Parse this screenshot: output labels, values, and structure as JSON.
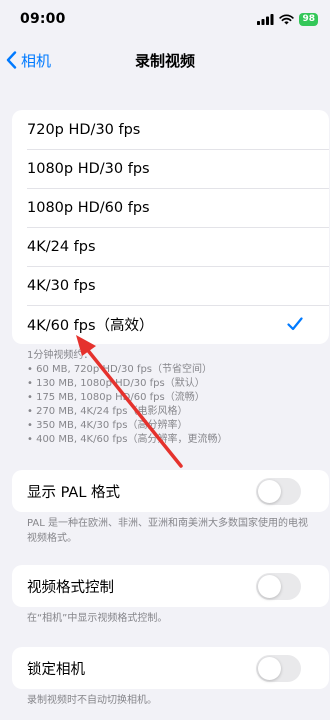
{
  "status_bar": {
    "time": "09:00",
    "battery": "98",
    "icons": [
      "signal-icon",
      "wifi-icon",
      "battery-icon"
    ]
  },
  "nav": {
    "back_label": "相机",
    "title": "录制视频"
  },
  "resolutions": [
    {
      "label": "720p HD/30 fps",
      "selected": false
    },
    {
      "label": "1080p HD/30 fps",
      "selected": false
    },
    {
      "label": "1080p HD/60 fps",
      "selected": false
    },
    {
      "label": "4K/24 fps",
      "selected": false
    },
    {
      "label": "4K/30 fps",
      "selected": false
    },
    {
      "label": "4K/60 fps（高效）",
      "selected": true
    }
  ],
  "size_info": [
    "1分钟视频约：",
    "• 60 MB, 720p HD/30 fps（节省空间）",
    "• 130 MB, 1080p HD/30 fps（默认）",
    "• 175 MB, 1080p HD/60 fps（流畅）",
    "• 270 MB, 4K/24 fps（电影风格）",
    "• 350 MB, 4K/30 fps（高分辨率）",
    "• 400 MB, 4K/60 fps（高分辨率，更流畅）"
  ],
  "pal": {
    "label": "显示 PAL 格式",
    "on": false,
    "footnote": "PAL 是一种在欧洲、非洲、亚洲和南美洲大多数国家使用的电视视频格式。"
  },
  "format_control": {
    "label": "视频格式控制",
    "on": false,
    "footnote": "在“相机”中显示视频格式控制。"
  },
  "lock_camera": {
    "label": "锁定相机",
    "on": false,
    "footnote": "录制视频时不自动切换相机。"
  },
  "colors": {
    "accent": "#007aff",
    "background": "#f2f2f7",
    "annotation_arrow": "#e5322d",
    "battery": "#34c759"
  }
}
